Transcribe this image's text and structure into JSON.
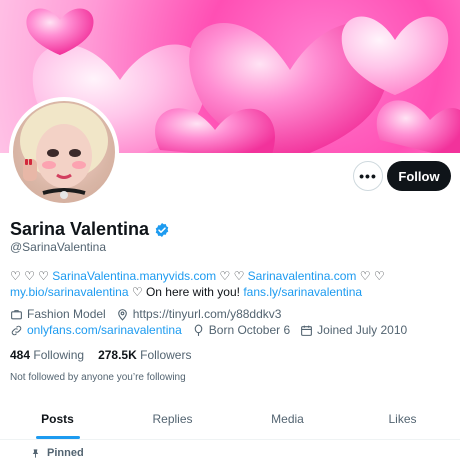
{
  "profile": {
    "display_name": "Sarina Valentina",
    "handle": "@SarinaValentina"
  },
  "actions": {
    "more": "•••",
    "follow": "Follow"
  },
  "bio": {
    "line1_prefix": "♡ ♡ ♡ ",
    "link1": "SarinaValentina.manyvids.com",
    "between1": " ♡ ♡ ",
    "link2": "Sarinavalentina.com",
    "line1_suffix": " ♡ ♡",
    "link3": "my.bio/sarinavalentina",
    "middle": " ♡ On here with you! ",
    "link4": "fans.ly/sarinavalentina"
  },
  "meta": {
    "profession": "Fashion Model",
    "location": "https://tinyurl.com/y88ddkv3",
    "website": "onlyfans.com/sarinavalentina",
    "birthday": "Born October 6",
    "joined": "Joined July 2010"
  },
  "counts": {
    "following_count": "484",
    "following_label": "Following",
    "followers_count": "278.5K",
    "followers_label": "Followers"
  },
  "not_followed": "Not followed by anyone you’re following",
  "tabs": [
    {
      "label": "Posts",
      "active": true
    },
    {
      "label": "Replies",
      "active": false
    },
    {
      "label": "Media",
      "active": false
    },
    {
      "label": "Likes",
      "active": false
    }
  ],
  "pinned_label": "Pinned",
  "colors": {
    "accent": "#1d9bf0",
    "text": "#0f1419",
    "muted": "#536471",
    "banner_pink": "#ff4fb4"
  }
}
